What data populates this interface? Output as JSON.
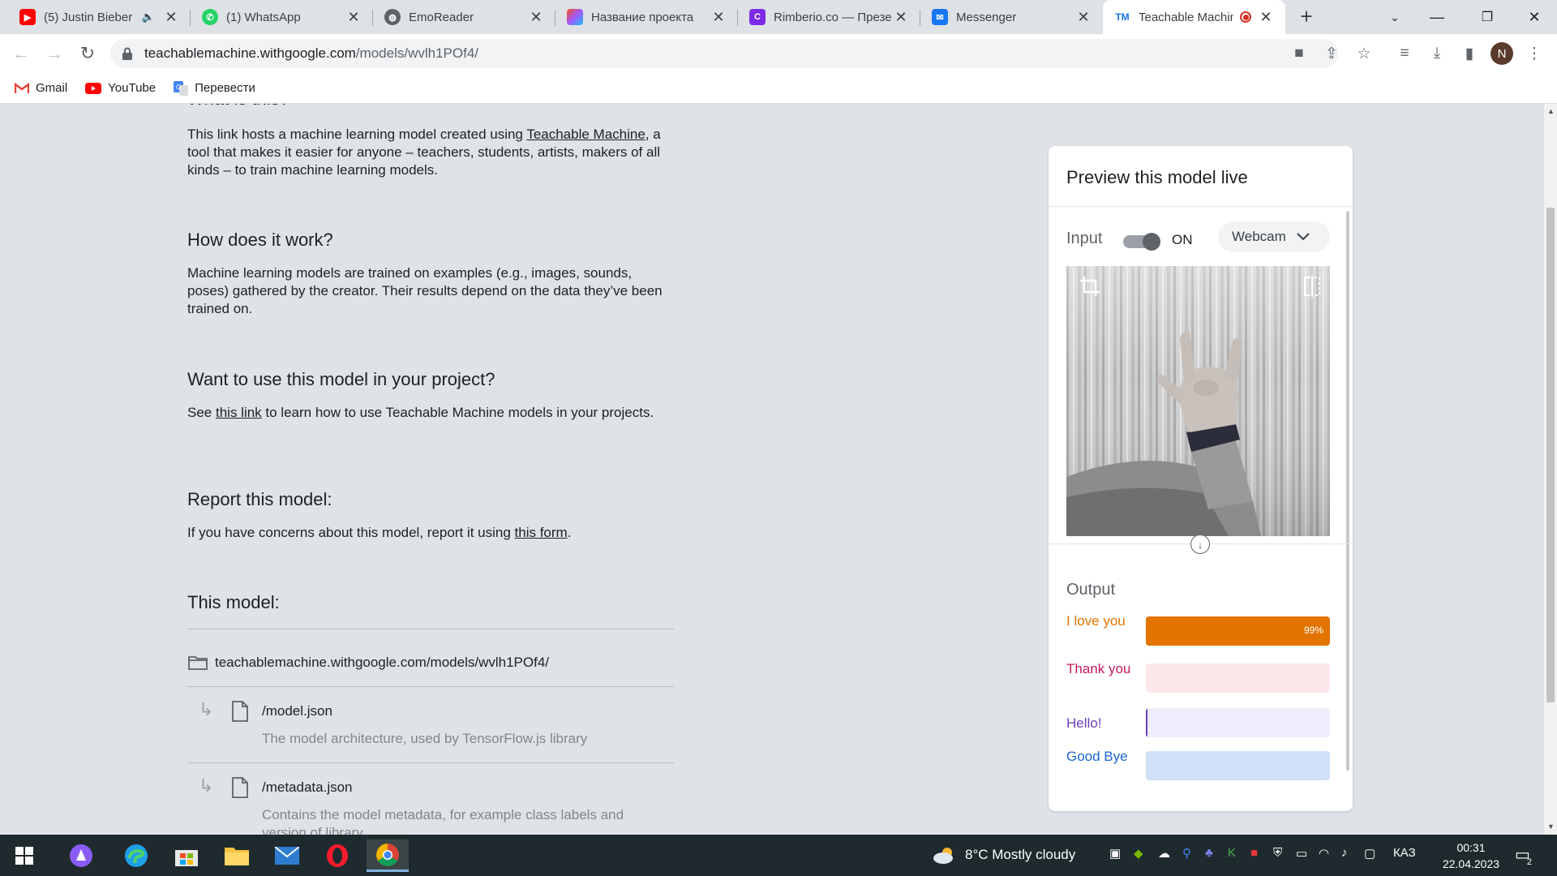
{
  "browser": {
    "tabs": [
      {
        "title": "(5) Justin Bieber -",
        "icon": "youtube-icon",
        "color": "#ff0000",
        "muted": true
      },
      {
        "title": "(1) WhatsApp",
        "icon": "whatsapp-icon",
        "color": "#25d366"
      },
      {
        "title": "EmoReader",
        "icon": "globe-icon",
        "color": "#5f6368"
      },
      {
        "title": "Название проекта",
        "icon": "figma-icon",
        "color": "#a259ff"
      },
      {
        "title": "Rimberio.co — Презе",
        "icon": "canva-icon",
        "color": "#7d2ae8"
      },
      {
        "title": "Messenger",
        "icon": "messenger-icon",
        "color": "#1877f2"
      },
      {
        "title": "Teachable Machin",
        "icon": "teachable-machine-icon",
        "color": "#1a73e8",
        "recording": true,
        "active": true
      }
    ],
    "url_host": "teachablemachine.withgoogle.com",
    "url_path": "/models/wvlh1POf4/",
    "profile_initial": "N",
    "bookmarks": [
      {
        "label": "Gmail",
        "icon": "gmail-icon"
      },
      {
        "label": "YouTube",
        "icon": "youtube-icon"
      },
      {
        "label": "Перевести",
        "icon": "translate-icon"
      }
    ]
  },
  "page": {
    "what_heading": "What is this?",
    "what_text": {
      "before": "This link hosts a machine learning model created using ",
      "link": "Teachable Machine",
      "after": ", a tool that makes it easier for anyone – teachers, students, artists, makers of all kinds – to train machine learning models."
    },
    "how_heading": "How does it work?",
    "how_text": "Machine learning models are trained on examples (e.g., images, sounds, poses) gathered by the creator. Their results depend on the data they’ve been trained on.",
    "want_heading": "Want to use this model in your project?",
    "want_text": {
      "before": "See ",
      "link": "this link",
      "after": " to learn how to use Teachable Machine models in your projects."
    },
    "report_heading": "Report this model:",
    "report_text": {
      "before": "If you have concerns about this model, report it using ",
      "link": "this form",
      "after": "."
    },
    "model_heading": "This model:",
    "model_folder": "teachablemachine.withgoogle.com/models/wvlh1POf4/",
    "files": [
      {
        "name": "/model.json",
        "description": "The model architecture, used by TensorFlow.js library"
      },
      {
        "name": "/metadata.json",
        "description": "Contains the model metadata, for example class labels and version of library"
      }
    ]
  },
  "preview": {
    "title": "Preview this model live",
    "input_label": "Input",
    "toggle_state": "ON",
    "source": "Webcam",
    "output_label": "Output",
    "classes": [
      {
        "name": "I love you",
        "confidence": 0.99,
        "percent_label": "99%",
        "text_color": "#e37400",
        "bar_bg": "#e37400",
        "fill_color": "#e37400"
      },
      {
        "name": "Thank you",
        "confidence": 0.0,
        "percent_label": "",
        "text_color": "#c2185b",
        "bar_bg": "#fde7ea",
        "fill_color": "#c2185b"
      },
      {
        "name": "Hello!",
        "confidence": 0.01,
        "percent_label": "",
        "text_color": "#6a3fb5",
        "bar_bg": "#efedfb",
        "fill_color": "#6a3fb5"
      },
      {
        "name": "Good Bye",
        "confidence": 0.0,
        "percent_label": "",
        "text_color": "#1967d2",
        "bar_bg": "#cfe0f7",
        "fill_color": "#1967d2"
      }
    ]
  },
  "taskbar": {
    "weather_temp": "8°C",
    "weather_text": "Mostly cloudy",
    "language": "КАЗ",
    "time": "00:31",
    "date": "22.04.2023",
    "notifications": "2"
  }
}
